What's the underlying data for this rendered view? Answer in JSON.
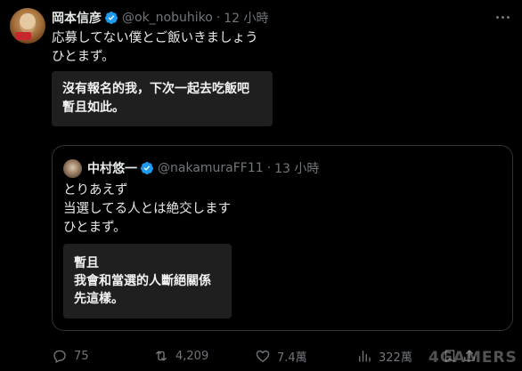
{
  "tweet": {
    "author_name": "岡本信彦",
    "author_handle": "@ok_nobuhiko",
    "separator": "·",
    "time": "12 小時",
    "text_line1": "応募してない僕とご飯いきましょう",
    "text_line2": "ひとまず。",
    "translation_line1": "沒有報名的我，下次一起去吃飯吧",
    "translation_line2": "暫且如此。"
  },
  "quote": {
    "author_name": "中村悠一",
    "author_handle": "@nakamuraFF11",
    "separator": "·",
    "time": "13 小時",
    "text_line1": "とりあえず",
    "text_line2": "当選してる人とは絶交します",
    "text_line3": "ひとまず。",
    "translation_line1": "暫且",
    "translation_line2": "我會和當選的人斷絕關係",
    "translation_line3": "先這樣。"
  },
  "actions": {
    "replies": "75",
    "retweets": "4,209",
    "likes": "7.4萬",
    "views": "322萬"
  },
  "icons": {
    "verified": "verified-badge-icon",
    "more": "more-icon",
    "reply": "reply-icon",
    "retweet": "retweet-icon",
    "like": "heart-icon",
    "views": "views-icon",
    "bookmark": "bookmark-icon",
    "share": "share-icon"
  },
  "colors": {
    "background": "#000000",
    "text": "#e7e9ea",
    "secondary": "#71767b",
    "verified": "#1d9bf0",
    "translation_box": "#1f1f1f"
  },
  "watermark": "4GAMERS"
}
